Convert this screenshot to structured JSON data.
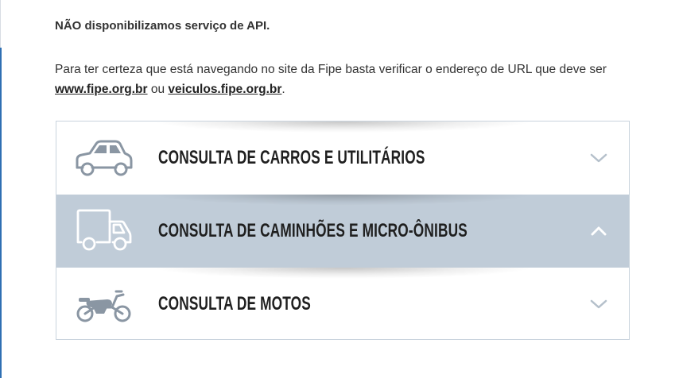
{
  "notice": {
    "api_text": "NÃO disponibilizamos serviço de API."
  },
  "info": {
    "text_before": "Para ter certeza que está navegando no site da Fipe basta verificar o endereço de URL que deve ser ",
    "link1": "www.fipe.org.br",
    "text_between": " ou ",
    "link2": "veiculos.fipe.org.br",
    "text_after": "."
  },
  "accordion": {
    "items": [
      {
        "label": "CONSULTA DE CARROS E UTILITÁRIOS",
        "icon": "car-icon",
        "chevron": "chevron-down-icon",
        "expanded": false
      },
      {
        "label": "CONSULTA DE CAMINHÕES E MICRO-ÔNIBUS",
        "icon": "truck-icon",
        "chevron": "chevron-up-icon",
        "expanded": true
      },
      {
        "label": "CONSULTA DE MOTOS",
        "icon": "motorcycle-icon",
        "chevron": "chevron-down-icon",
        "expanded": false
      }
    ]
  },
  "colors": {
    "active_row": "#c0ccd8",
    "icon_color": "#8a96a3",
    "active_icon_color": "#ffffff",
    "chevron_color": "#b5c0cb",
    "left_border": "#2f6fb3"
  }
}
